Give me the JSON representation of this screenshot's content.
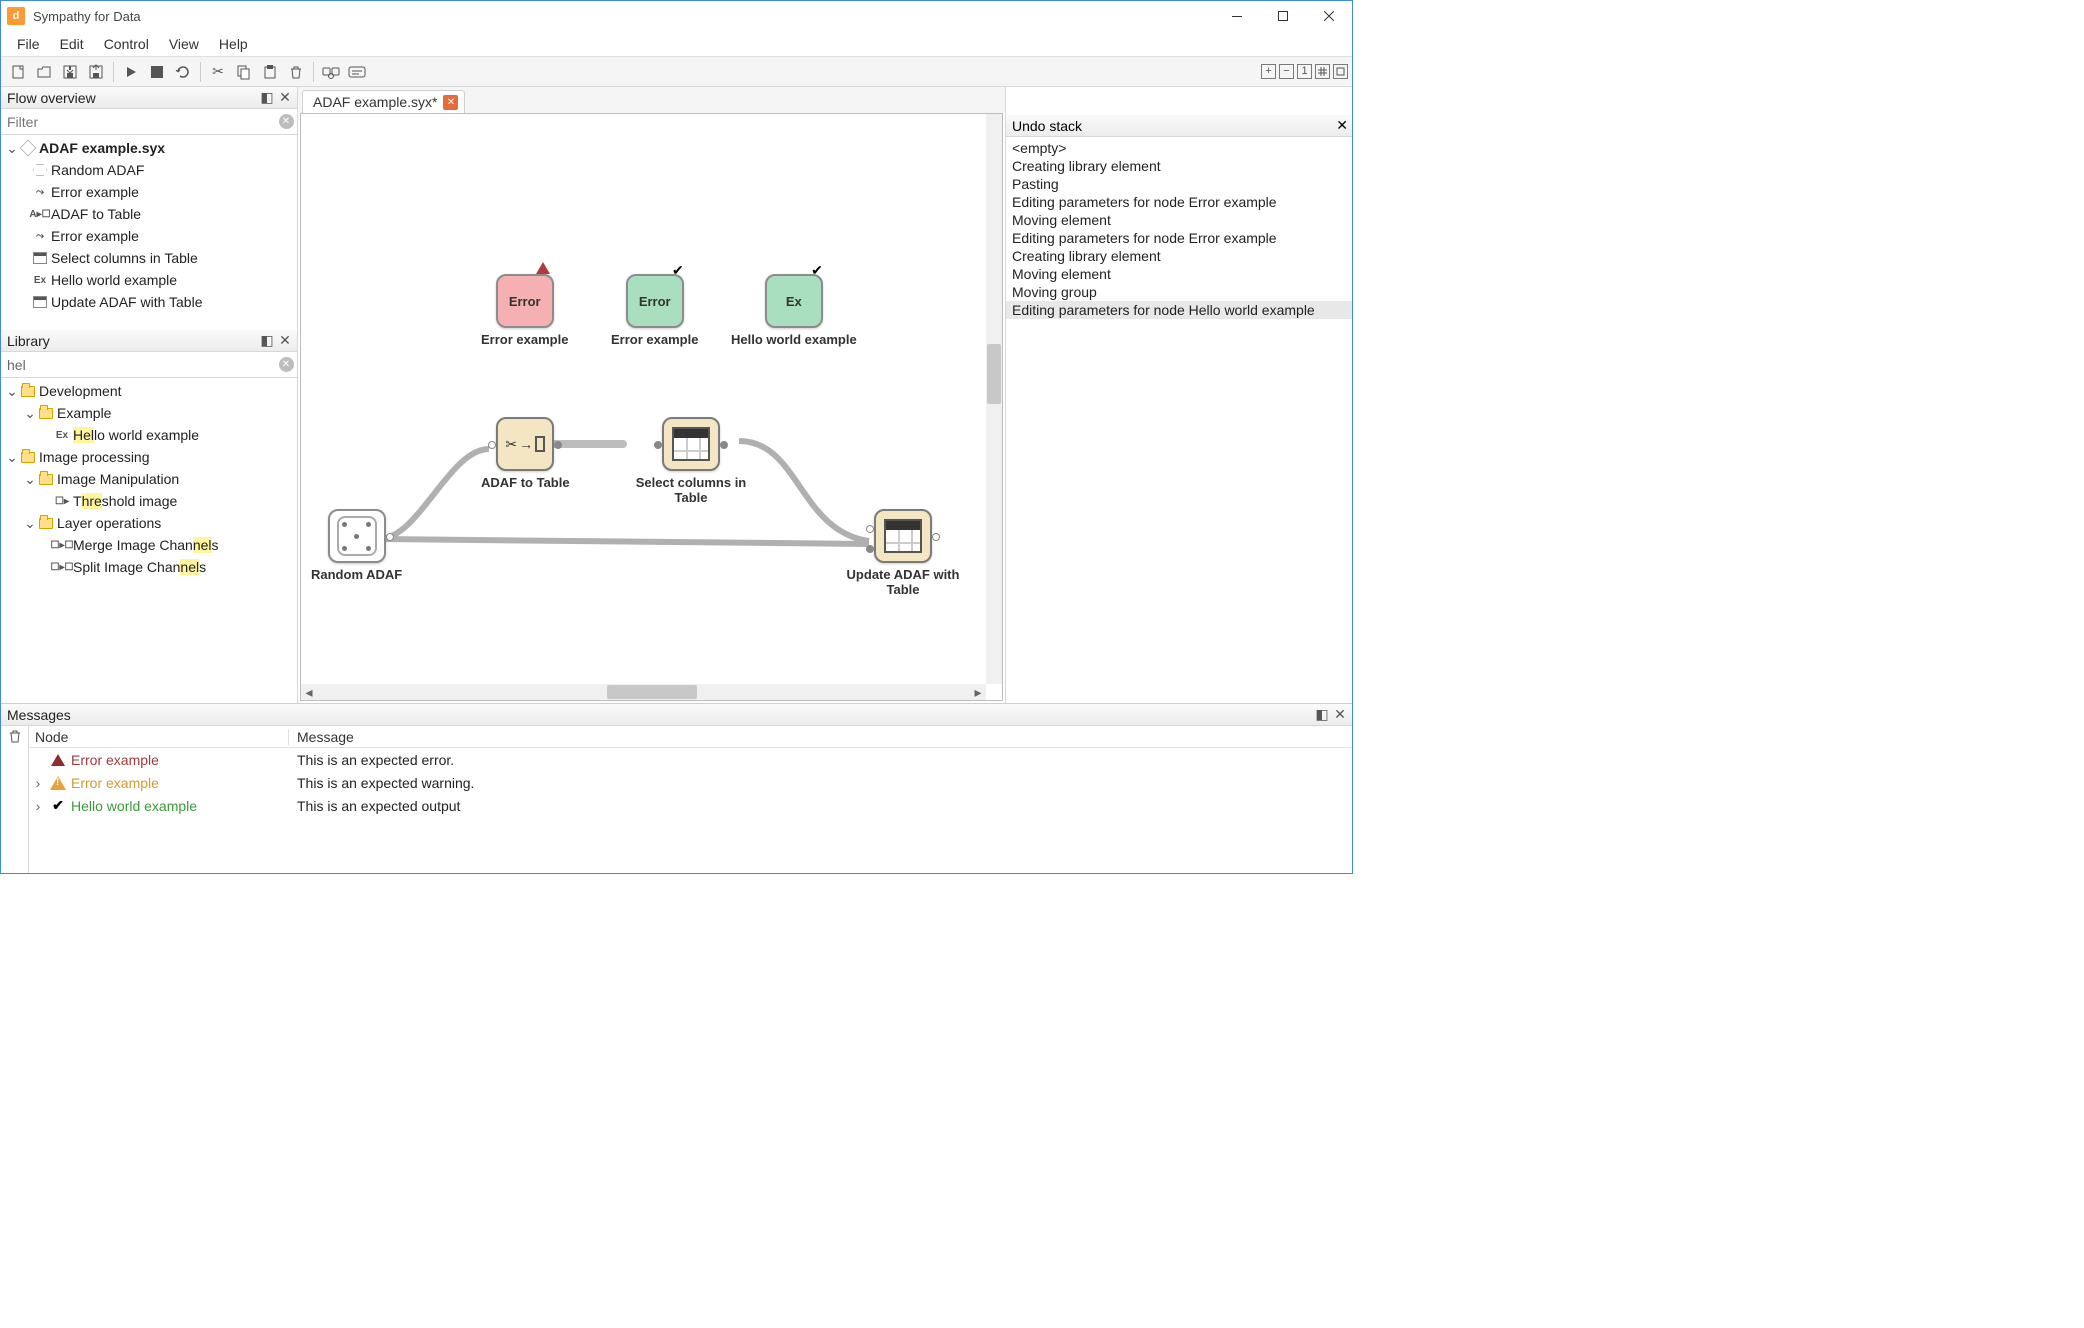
{
  "title": "Sympathy for Data",
  "menu": [
    "File",
    "Edit",
    "Control",
    "View",
    "Help"
  ],
  "flow_overview": {
    "title": "Flow overview",
    "filter_placeholder": "Filter",
    "root": "ADAF example.syx",
    "items": [
      "Random ADAF",
      "Error example",
      "ADAF to Table",
      "Error example",
      "Select columns in Table",
      "Hello world example",
      "Update ADAF with Table"
    ]
  },
  "library": {
    "title": "Library",
    "filter_value": "hel",
    "tree": {
      "dev": "Development",
      "example": "Example",
      "hello": "Hello world example",
      "imgproc": "Image processing",
      "imgman": "Image Manipulation",
      "thresh": "Threshold image",
      "layer": "Layer operations",
      "merge": "Merge Image Channels",
      "split": "Split Image Channels"
    }
  },
  "tab": {
    "label": "ADAF example.syx*"
  },
  "nodes": {
    "error_red": "Error example",
    "error_green": "Error example",
    "hello": "Hello world example",
    "adaf_table": "ADAF to Table",
    "select_cols": "Select columns in Table",
    "random": "Random ADAF",
    "update": "Update ADAF with Table",
    "node_error_text": "Error",
    "node_ex_text": "Ex"
  },
  "undo": {
    "title": "Undo stack",
    "items": [
      "<empty>",
      "Creating library element",
      "Pasting",
      "Editing parameters for node Error example",
      "Moving element",
      "Editing parameters for node Error example",
      "Creating library element",
      "Moving element",
      "Moving group",
      "Editing parameters for node Hello world example"
    ]
  },
  "messages": {
    "title": "Messages",
    "col_node": "Node",
    "col_msg": "Message",
    "rows": [
      {
        "name": "Error example",
        "msg": "This is an expected error.",
        "kind": "err"
      },
      {
        "name": "Error example",
        "msg": "This is an expected warning.",
        "kind": "warn"
      },
      {
        "name": "Hello world example",
        "msg": "This is an expected output",
        "kind": "ok"
      }
    ]
  }
}
